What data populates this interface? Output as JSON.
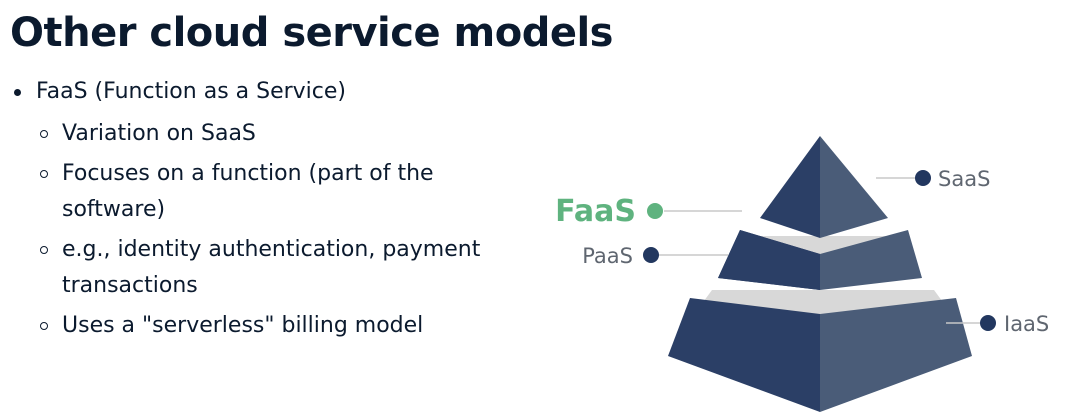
{
  "slide": {
    "title": "Other cloud service models",
    "bullet": "FaaS (Function as a Service)",
    "sub_bullets": [
      "Variation on SaaS",
      "Focuses on a function (part of the software)",
      "e.g., identity authentication, payment transactions",
      "Uses a \"serverless\" billing model"
    ]
  },
  "diagram": {
    "labels": {
      "saas": "SaaS",
      "faas": "FaaS",
      "paas": "PaaS",
      "iaas": "IaaS"
    },
    "colors": {
      "dark": "#2b3f66",
      "light": "#4a5c78",
      "gap": "#d8d8d8",
      "dot": "#22375f",
      "faas": "#5fb37f",
      "label": "#5f6670"
    }
  }
}
